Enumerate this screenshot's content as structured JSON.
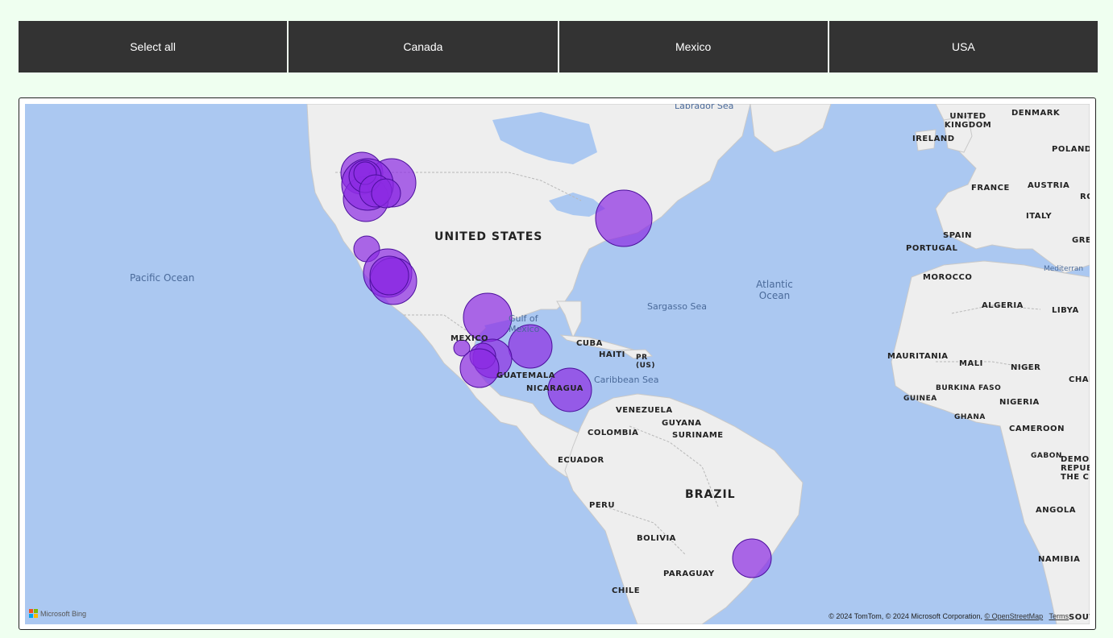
{
  "slicer": {
    "buttons": [
      {
        "label": "Select all"
      },
      {
        "label": "Canada"
      },
      {
        "label": "Mexico"
      },
      {
        "label": "USA"
      }
    ]
  },
  "map": {
    "labels": {
      "united_states": "UNITED STATES",
      "pacific_ocean": "Pacific Ocean",
      "atlantic_ocean": "Atlantic Ocean",
      "labrador_sea": "Labrador Sea",
      "sargasso_sea": "Sargasso Sea",
      "gulf_of_mexico": "Gulf of Mexico",
      "caribbean_sea": "Caribbean Sea",
      "mediterranean": "Mediterran",
      "mexico": "MEXICO",
      "cuba": "CUBA",
      "haiti": "HAITI",
      "pr": "PR (US)",
      "guatemala": "GUATEMALA",
      "nicaragua": "NICARAGUA",
      "venezuela": "VENEZUELA",
      "guyana": "GUYANA",
      "suriname": "SURINAME",
      "colombia": "COLOMBIA",
      "ecuador": "ECUADOR",
      "peru": "PERU",
      "brazil": "BRAZIL",
      "bolivia": "BOLIVIA",
      "paraguay": "PARAGUAY",
      "chile": "CHILE",
      "united_kingdom": "UNITED KINGDOM",
      "ireland": "IRELAND",
      "denmark": "DENMARK",
      "poland": "POLAND",
      "france": "FRANCE",
      "austria": "AUSTRIA",
      "italy": "ITALY",
      "spain": "SPAIN",
      "portugal": "PORTUGAL",
      "morocco": "MOROCCO",
      "algeria": "ALGERIA",
      "libya": "LIBYA",
      "mauritania": "MAURITANIA",
      "mali": "MALI",
      "niger": "NIGER",
      "chad": "CHAD",
      "burkina_faso": "BURKINA FASO",
      "guinea": "GUINEA",
      "ghana": "GHANA",
      "nigeria": "NIGERIA",
      "cameroon": "CAMEROON",
      "gabon": "GABON",
      "democ": "DEMOC REPUB THE C",
      "angola": "ANGOLA",
      "namibia": "NAMIBIA",
      "south": "SOUTH",
      "ro": "RO",
      "gre": "GRE"
    },
    "bubble_color": "#8b2be2",
    "ocean_color": "#abc8f1",
    "land_color": "#eeeeee",
    "attribution": "© 2024 TomTom, © 2024 Microsoft Corporation,",
    "osm_link": "© OpenStreetMap",
    "terms_link": "Terms",
    "bing_label": "Microsoft Bing"
  }
}
